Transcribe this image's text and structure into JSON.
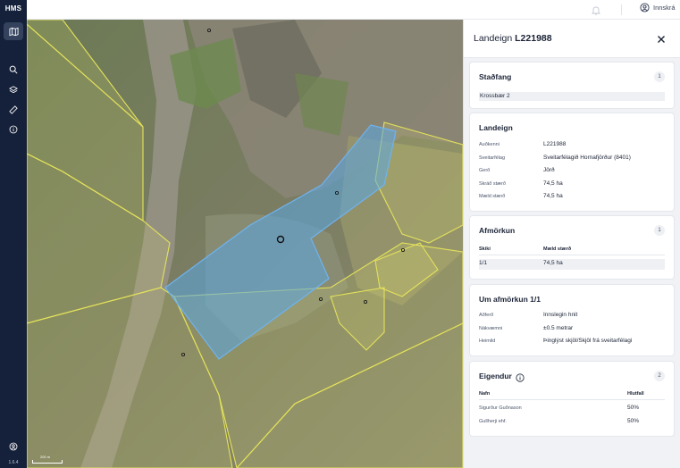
{
  "app": {
    "logo": "HMS",
    "version": "1.6.4"
  },
  "topbar": {
    "login_label": "Innskrá"
  },
  "panel": {
    "title_prefix": "Landeign",
    "title_id": "L221988",
    "stadfang": {
      "heading": "Staðfang",
      "count": "1",
      "address": "Krossbær 2"
    },
    "landeign": {
      "heading": "Landeign",
      "fields": [
        {
          "label": "Auðkenni",
          "value": "L221988"
        },
        {
          "label": "Sveitarfélag",
          "value": "Sveitarfélagið Hornafjörður (8401)"
        },
        {
          "label": "Gerð",
          "value": "Jörð"
        },
        {
          "label": "Skráð stærð",
          "value": "74,5 ha"
        },
        {
          "label": "Mæld stærð",
          "value": "74,5 ha"
        }
      ]
    },
    "afmorkun": {
      "heading": "Afmörkun",
      "count": "1",
      "col_skiki": "Skiki",
      "col_maeld": "Mæld stærð",
      "row_skiki": "1/1",
      "row_maeld": "74,5 ha"
    },
    "um_afmorkun": {
      "heading": "Um afmörkun 1/1",
      "fields": [
        {
          "label": "Aðferð",
          "value": "Innslegin hnit"
        },
        {
          "label": "Nákvæmni",
          "value": "±0.5 metrar"
        },
        {
          "label": "Heimild",
          "value": "Þinglýst skjöl/Skjöl frá sveitarfélagi"
        }
      ]
    },
    "eigendur": {
      "heading": "Eigendur",
      "count": "2",
      "col_nafn": "Nafn",
      "col_hlutfall": "Hlutfall",
      "owners": [
        {
          "name": "Sigurður Guðnason",
          "share": "50%"
        },
        {
          "name": "Gullherji ehf.",
          "share": "50%"
        }
      ]
    }
  },
  "map": {
    "scale_label": "200 m"
  },
  "colors": {
    "rail": "#15213a",
    "selected_parcel": "#5aa7e6",
    "parcel_outline": "#e4e25a"
  }
}
